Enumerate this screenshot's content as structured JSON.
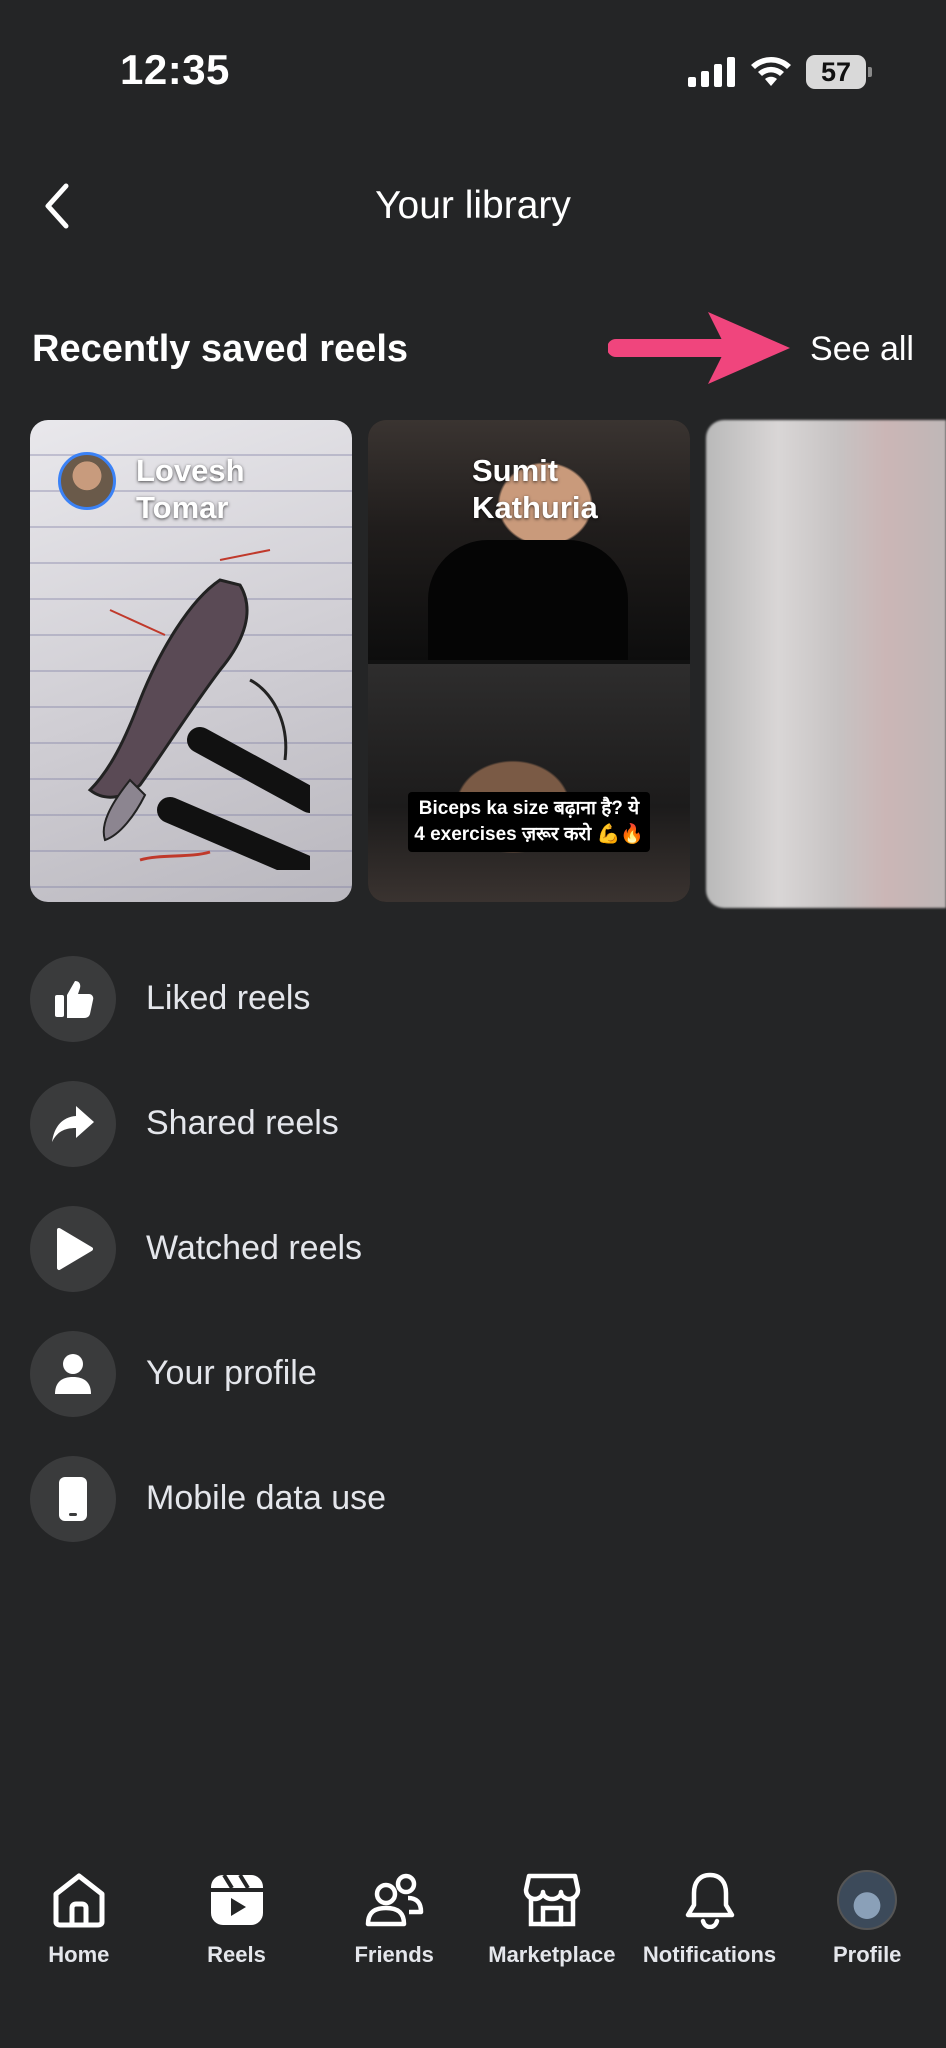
{
  "status_bar": {
    "time": "12:35",
    "battery": "57"
  },
  "header": {
    "title": "Your library"
  },
  "saved_reels": {
    "title": "Recently saved reels",
    "see_all": "See all",
    "reels": [
      {
        "author": "Lovesh Tomar"
      },
      {
        "author": "Sumit Kathuria",
        "caption": "Biceps ka size बढ़ाना है? ये 4 exercises ज़रूर करो 💪🔥"
      },
      {
        "author": ""
      }
    ]
  },
  "menu": {
    "items": [
      {
        "label": "Liked reels",
        "icon": "thumbs-up-icon"
      },
      {
        "label": "Shared reels",
        "icon": "share-arrow-icon"
      },
      {
        "label": "Watched reels",
        "icon": "play-icon"
      },
      {
        "label": "Your profile",
        "icon": "person-icon"
      },
      {
        "label": "Mobile data use",
        "icon": "phone-icon"
      }
    ]
  },
  "bottom_nav": {
    "items": [
      {
        "label": "Home",
        "icon": "home-icon"
      },
      {
        "label": "Reels",
        "icon": "reels-icon"
      },
      {
        "label": "Friends",
        "icon": "friends-icon"
      },
      {
        "label": "Marketplace",
        "icon": "marketplace-icon"
      },
      {
        "label": "Notifications",
        "icon": "bell-icon"
      },
      {
        "label": "Profile",
        "icon": "profile-avatar"
      }
    ]
  },
  "colors": {
    "background": "#242526",
    "icon_circle": "#3a3b3c",
    "annotation_arrow": "#f0457d"
  }
}
